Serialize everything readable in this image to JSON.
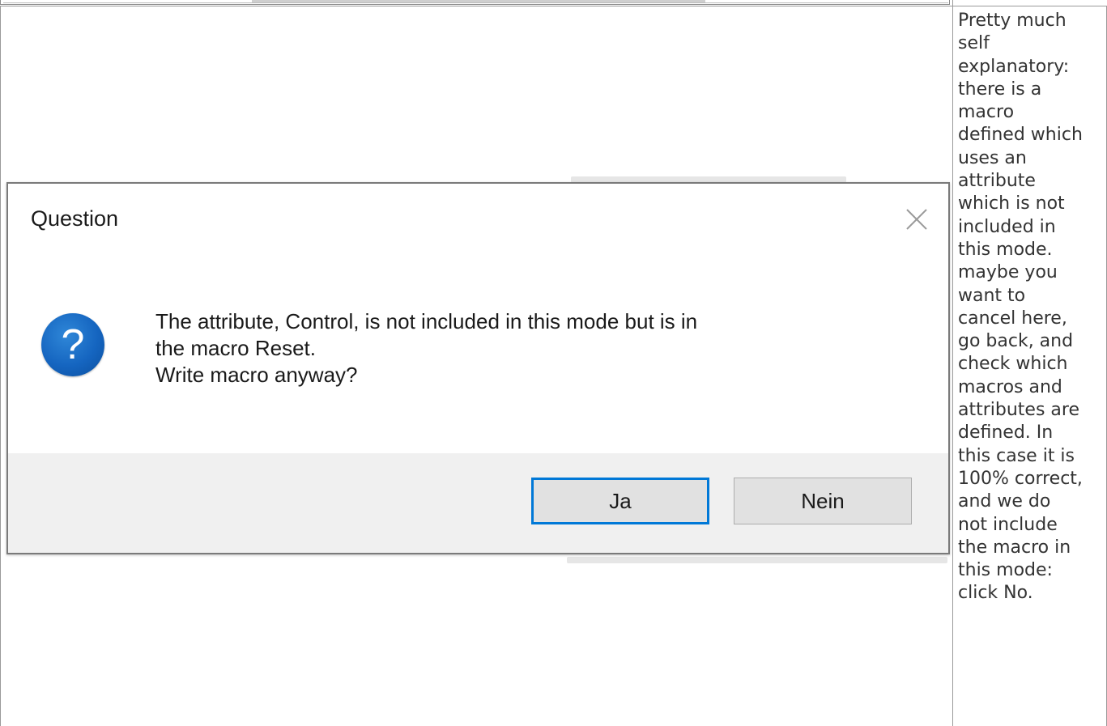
{
  "dialog": {
    "title": "Question",
    "close_icon": "close-icon",
    "icon": "question-mark-icon",
    "icon_color": "#1565c0",
    "message_lines": [
      "The attribute, Control, is not included in this mode but is in",
      "the macro Reset.",
      "Write macro anyway?"
    ],
    "yes_label": "Ja",
    "no_label": "Nein",
    "accent": "#0078d7"
  },
  "description": {
    "text": "Pretty much\nself\nexplanatory:\nthere is a\nmacro\ndefined which\nuses an\nattribute\nwhich is not\nincluded in\nthis mode.\nmaybe you\nwant to\ncancel here,\ngo back, and\ncheck which\nmacros and\nattributes are\ndefined. In\nthis case it is\n100% correct,\nand we do\nnot include\nthe macro in\nthis mode:\nclick No."
  }
}
